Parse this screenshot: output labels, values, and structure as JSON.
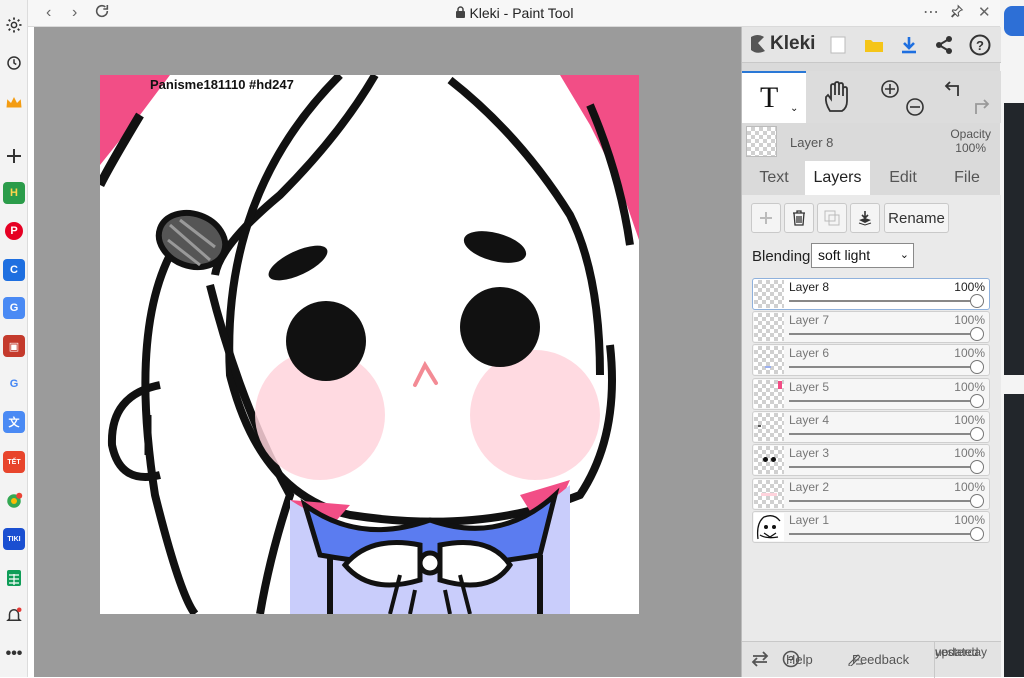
{
  "window": {
    "title": "Kleki - Paint Tool"
  },
  "sidebar": {
    "icons": [
      "settings-icon",
      "history-icon",
      "crown-icon",
      "plus-icon",
      "h-app-icon",
      "pinterest-icon",
      "blue-app-icon",
      "translate-icon",
      "shield-app-icon",
      "google-icon",
      "translate-doc-icon",
      "tet-app-icon",
      "chrome-app-icon",
      "tiki-app-icon",
      "sheets-icon",
      "bell-icon",
      "more-icon"
    ],
    "tiki_label": "TIKI",
    "tet_label": "TẾT"
  },
  "kleki": {
    "logo": "Kleki",
    "layer_preview_name": "Layer 8",
    "opacity_label": "Opacity",
    "opacity_value": "100%",
    "tabs": [
      "Text",
      "Layers",
      "Edit",
      "File"
    ],
    "rename_label": "Rename",
    "blending_label": "Blending",
    "blending_value": "soft light",
    "layers": [
      {
        "name": "Layer 8",
        "opacity": "100%"
      },
      {
        "name": "Layer 7",
        "opacity": "100%"
      },
      {
        "name": "Layer 6",
        "opacity": "100%"
      },
      {
        "name": "Layer 5",
        "opacity": "100%"
      },
      {
        "name": "Layer 4",
        "opacity": "100%"
      },
      {
        "name": "Layer 3",
        "opacity": "100%"
      },
      {
        "name": "Layer 2",
        "opacity": "100%"
      },
      {
        "name": "Layer 1",
        "opacity": "100%"
      }
    ],
    "footer": {
      "help": "Help",
      "feedback": "Feedback",
      "updated_line1": "updated",
      "updated_line2": "yesterday"
    }
  },
  "canvas": {
    "watermark": "Panisme181110 #hd247"
  },
  "colors": {
    "accent": "#2a78d6",
    "pink": "#f24e86",
    "blue_collar": "#5b7cf0"
  }
}
